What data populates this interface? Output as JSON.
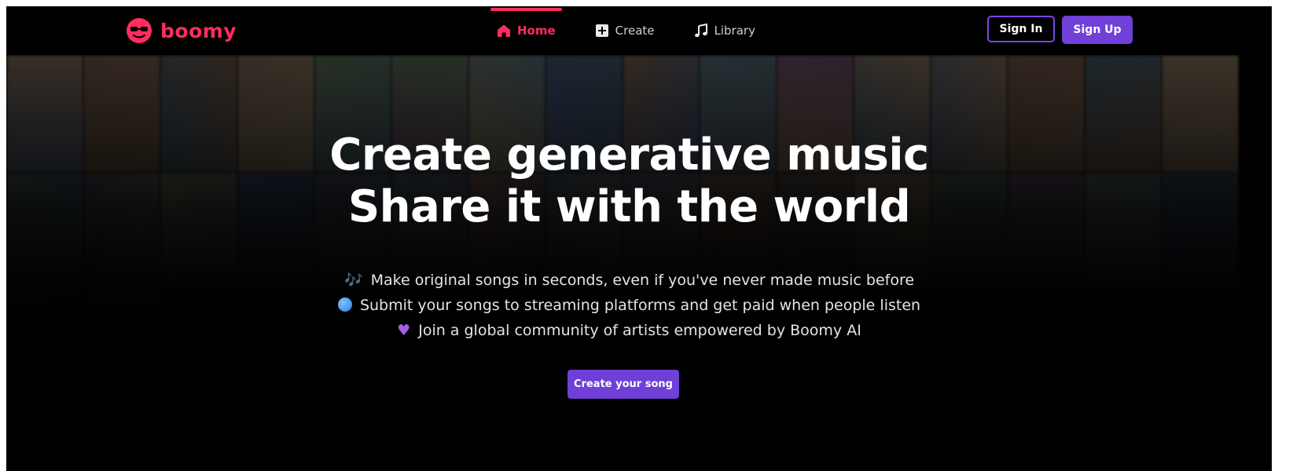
{
  "brand": {
    "name": "boomy",
    "color": "#ff2d5f"
  },
  "nav": {
    "items": [
      {
        "label": "Home",
        "icon": "home-icon",
        "active": true
      },
      {
        "label": "Create",
        "icon": "plus-square-icon",
        "active": false
      },
      {
        "label": "Library",
        "icon": "music-note-icon",
        "active": false
      }
    ]
  },
  "auth": {
    "sign_in": "Sign In",
    "sign_up": "Sign Up"
  },
  "hero": {
    "title_line1": "Create generative music",
    "title_line2": "Share it with the world",
    "features": [
      {
        "icon": "musical-notes-icon",
        "glyph": "🎶",
        "text": "Make original songs in seconds, even if you've never made music before"
      },
      {
        "icon": "globe-icon",
        "glyph": "",
        "text": "Submit your songs to streaming platforms and get paid when people listen"
      },
      {
        "icon": "purple-heart-icon",
        "glyph": "♥",
        "text": "Join a global community of artists empowered by Boomy AI"
      }
    ],
    "cta": "Create your song"
  },
  "colors": {
    "accent_pink": "#ff2d5f",
    "accent_purple": "#7040d8",
    "background": "#000000"
  }
}
